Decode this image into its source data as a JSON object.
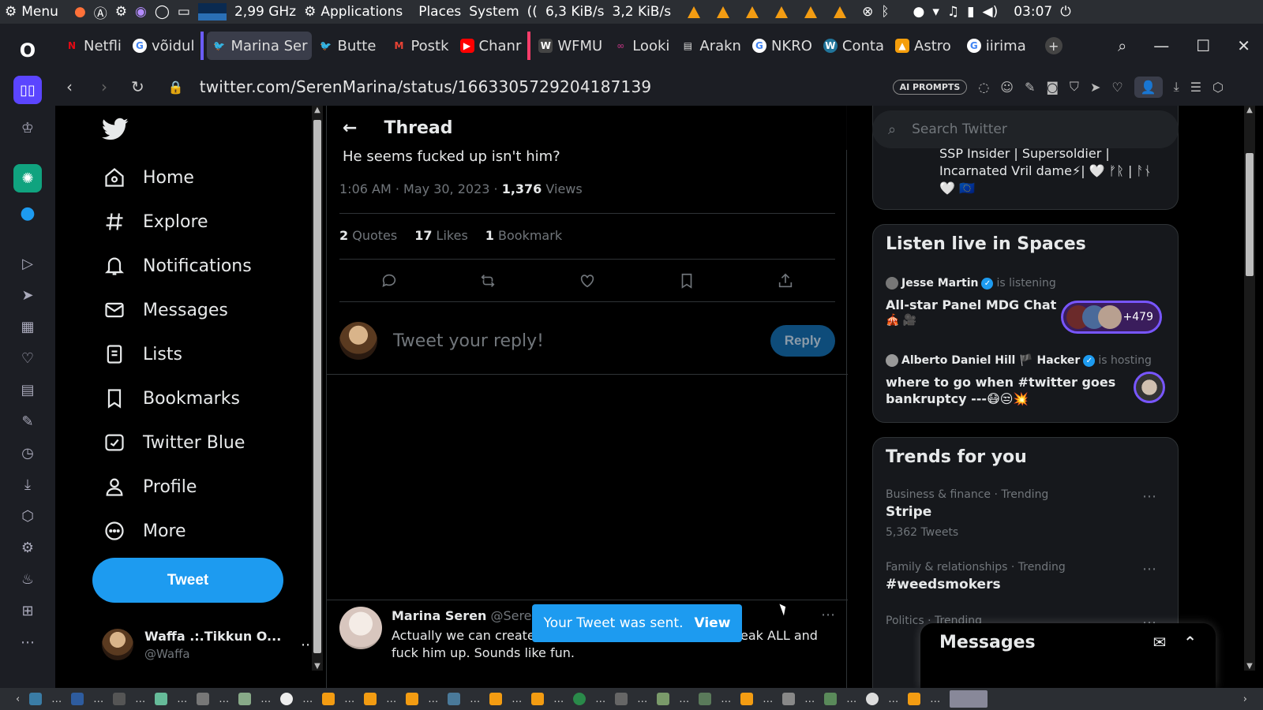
{
  "system_bar": {
    "menu": "Menu",
    "cpu": "2,99 GHz",
    "applications": "Applications",
    "places": "Places",
    "system": "System",
    "net_down": "6,3 KiB/s",
    "net_up": "3,2 KiB/s",
    "clock": "03:07"
  },
  "tabs": [
    {
      "label": "Netfli",
      "icon": "netflix-icon",
      "color": "#e50914",
      "letter": "N"
    },
    {
      "label": "võidul",
      "icon": "google-icon",
      "color": "#fff",
      "letter": "G"
    },
    {
      "label": "Marina Ser",
      "icon": "twitter-icon",
      "color": "#1d9bf0",
      "letter": "t"
    },
    {
      "label": "Butte",
      "icon": "twitter-icon",
      "color": "#1d9bf0",
      "letter": "t"
    },
    {
      "label": "Postk",
      "icon": "gmail-icon",
      "color": "#ea4335",
      "letter": "M"
    },
    {
      "label": "Chanr",
      "icon": "youtube-icon",
      "color": "#ff0000",
      "letter": "▶"
    },
    {
      "label": "WFMU",
      "icon": "wfmu-icon",
      "color": "#555",
      "letter": "W"
    },
    {
      "label": "Looki",
      "icon": "site-icon",
      "color": "#6a1b4d",
      "letter": "∞"
    },
    {
      "label": "Arakn",
      "icon": "doc-icon",
      "color": "#eee",
      "letter": "▤"
    },
    {
      "label": "NKRO",
      "icon": "google-icon",
      "color": "#fff",
      "letter": "G"
    },
    {
      "label": "Conta",
      "icon": "wordpress-icon",
      "color": "#21759b",
      "letter": "W"
    },
    {
      "label": "Astro",
      "icon": "astro-icon",
      "color": "#f59e0b",
      "letter": "▲"
    },
    {
      "label": "iirima",
      "icon": "google-icon",
      "color": "#fff",
      "letter": "G"
    }
  ],
  "address": {
    "url": "twitter.com/SerenMarina/status/1663305729204187139",
    "ai_prompts": "AI PROMPTS"
  },
  "nav": {
    "items": [
      {
        "label": "Home",
        "icon": "home-icon"
      },
      {
        "label": "Explore",
        "icon": "hashtag-icon"
      },
      {
        "label": "Notifications",
        "icon": "bell-icon"
      },
      {
        "label": "Messages",
        "icon": "mail-icon"
      },
      {
        "label": "Lists",
        "icon": "list-icon"
      },
      {
        "label": "Bookmarks",
        "icon": "bookmark-icon"
      },
      {
        "label": "Twitter Blue",
        "icon": "twitter-blue-icon"
      },
      {
        "label": "Profile",
        "icon": "person-icon"
      },
      {
        "label": "More",
        "icon": "more-circle-icon"
      }
    ],
    "tweet_button": "Tweet",
    "account": {
      "name": "Waffa .:.Tikkun O...",
      "handle": "@Waffa"
    }
  },
  "thread": {
    "title": "Thread",
    "text_tail": "He seems fucked up isn't him?",
    "time": "1:06 AM · May 30, 2023 · ",
    "views_count": "1,376",
    "views_label": " Views",
    "quotes_count": "2",
    "quotes_label": " Quotes",
    "likes_count": "17",
    "likes_label": " Likes",
    "bookmarks_count": "1",
    "bookmarks_label": " Bookmark",
    "reply_placeholder": "Tweet your reply!",
    "reply_button": "Reply",
    "reply_tweet": {
      "name": "Marina Seren",
      "handle": "@SerenM",
      "text_line1_start": "Actually we can create a",
      "text_line1_end": "eak ALL and",
      "text_line2": "fuck him up. Sounds like fun."
    }
  },
  "toast": {
    "message": "Your Tweet was sent.",
    "action": "View"
  },
  "sidebar": {
    "search_placeholder": "Search Twitter",
    "bio_line1": "SSP Insider | Supersoldier |",
    "bio_line2": "Incarnated Vril dame⚡| 🤍 ᚠᚱ | ᚨᚾ",
    "bio_line3": "🤍 🇪🇺",
    "spaces_title": "Listen live in Spaces",
    "spaces": [
      {
        "host": "Jesse Martin",
        "status": "is listening",
        "title": "All-star Panel MDG Chat",
        "emoji": "🎪 🎥",
        "count": "+479"
      },
      {
        "host": "Alberto Daniel Hill 🏴 Hacker",
        "status": "is hosting",
        "title": "where to go when #twitter goes",
        "title2": "bankruptcy ---😷😒💥"
      }
    ],
    "trends_title": "Trends for you",
    "trends": [
      {
        "context": "Business & finance · Trending",
        "name": "Stripe",
        "count": "5,362 Tweets"
      },
      {
        "context": "Family & relationships · Trending",
        "name": "#weedsmokers",
        "count": ""
      },
      {
        "context": "Politics · Trending",
        "name": "",
        "count": ""
      }
    ]
  },
  "messages_drawer": {
    "title": "Messages"
  }
}
